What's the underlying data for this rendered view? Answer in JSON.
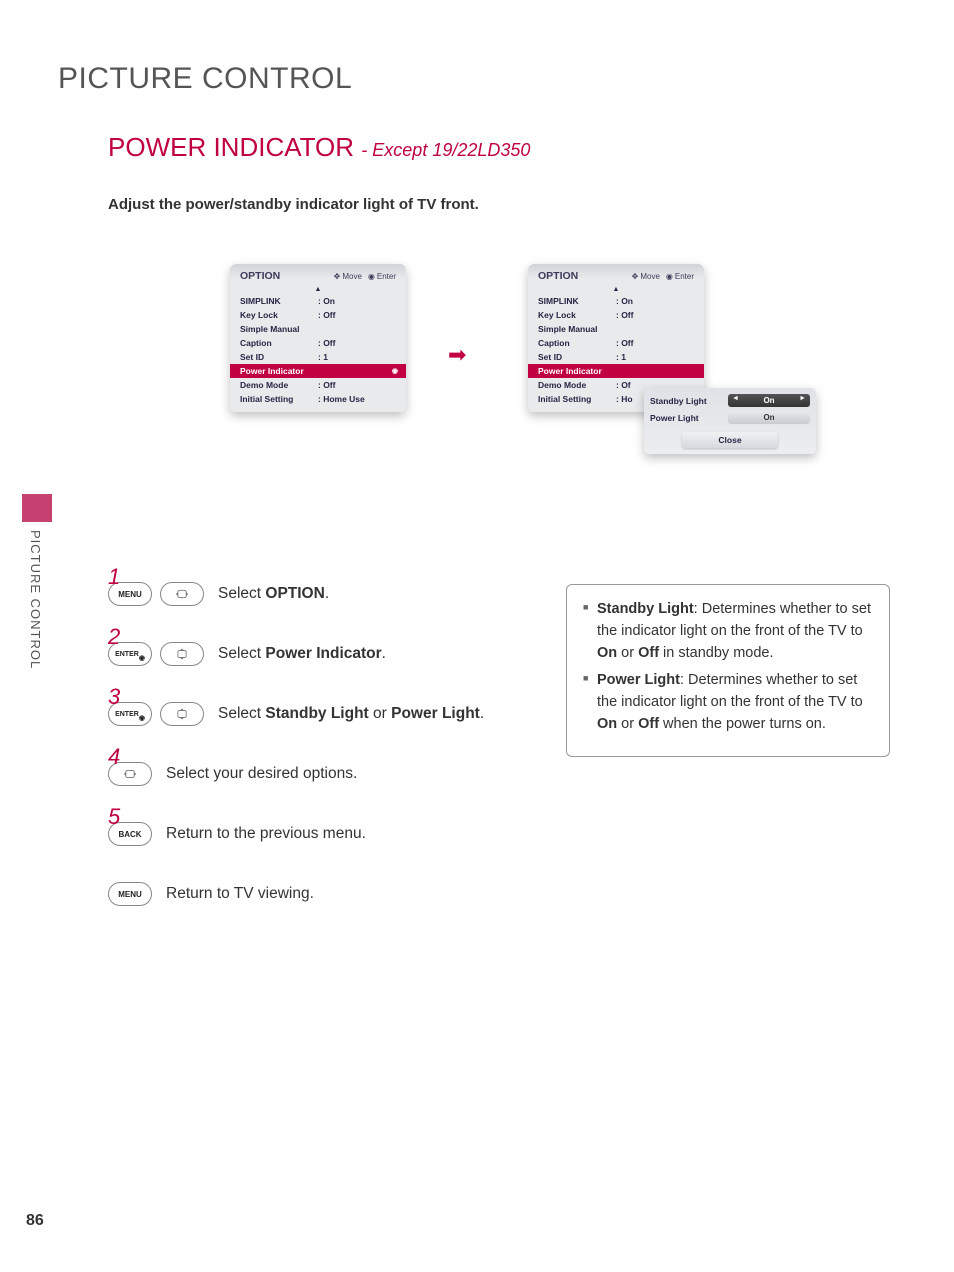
{
  "page": {
    "title": "PICTURE CONTROL",
    "page_number": "86",
    "side_tab": "PICTURE CONTROL"
  },
  "section": {
    "title": "POWER INDICATOR",
    "subtitle": "- Except 19/22LD350",
    "description": "Adjust the power/standby indicator light of TV front."
  },
  "osd": {
    "header_title": "OPTION",
    "hint_move": "Move",
    "hint_enter": "Enter",
    "items": [
      {
        "label": "SIMPLINK",
        "value": ": On"
      },
      {
        "label": "Key Lock",
        "value": ": Off"
      },
      {
        "label": "Simple Manual",
        "value": ""
      },
      {
        "label": "Caption",
        "value": ": Off"
      },
      {
        "label": "Set ID",
        "value": ": 1"
      },
      {
        "label": "Power Indicator",
        "value": ""
      },
      {
        "label": "Demo Mode",
        "value": ": Off"
      },
      {
        "label": "Initial Setting",
        "value": ": Home Use"
      }
    ],
    "items_right_tail": [
      {
        "label": "Demo Mode",
        "value": ": Of"
      },
      {
        "label": "Initial Setting",
        "value": ": Ho"
      }
    ],
    "popup": {
      "rows": [
        {
          "label": "Standby Light",
          "value": "On",
          "arrows": true,
          "dark": true
        },
        {
          "label": "Power Light",
          "value": "On",
          "arrows": false,
          "dark": false
        }
      ],
      "close": "Close"
    }
  },
  "steps": [
    {
      "num": "1",
      "btns": [
        "MENU",
        "dpad-h"
      ],
      "text_prefix": "Select ",
      "bold": "OPTION",
      "text_suffix": "."
    },
    {
      "num": "2",
      "btns": [
        "ENTER",
        "dpad-v"
      ],
      "text_prefix": "Select ",
      "bold": "Power Indicator",
      "text_suffix": "."
    },
    {
      "num": "3",
      "btns": [
        "ENTER",
        "dpad-v"
      ],
      "text_prefix": "Select ",
      "bold": "Standby Light",
      "mid": " or ",
      "bold2": "Power Light",
      "text_suffix": "."
    },
    {
      "num": "4",
      "btns": [
        "dpad-h"
      ],
      "text_prefix": "Select your desired options.",
      "bold": "",
      "text_suffix": ""
    },
    {
      "num": "5",
      "btns": [
        "BACK"
      ],
      "text_prefix": "Return to the previous menu.",
      "bold": "",
      "text_suffix": ""
    },
    {
      "num": "",
      "btns": [
        "MENU"
      ],
      "text_prefix": "Return to TV viewing.",
      "bold": "",
      "text_suffix": ""
    }
  ],
  "info": {
    "items": [
      {
        "term": "Standby Light",
        "desc_a": ": Determines whether to set the indicator light on the front of the TV to ",
        "on": "On",
        "or": " or ",
        "off": "Off",
        "desc_b": " in standby mode."
      },
      {
        "term": "Power Light",
        "desc_a": ": Determines whether to set the indicator light on the front of the TV to ",
        "on": "On",
        "or": " or ",
        "off": "Off",
        "desc_b": " when the power turns on."
      }
    ]
  },
  "buttons": {
    "MENU": "MENU",
    "ENTER": "ENTER",
    "BACK": "BACK"
  }
}
